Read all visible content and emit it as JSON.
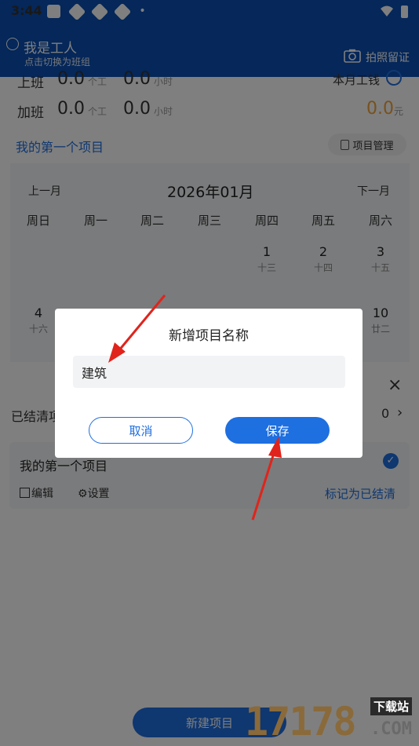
{
  "status_bar": {
    "time": "3:44",
    "dot": "•"
  },
  "header": {
    "role_title": "我是工人",
    "role_subtitle": "点击切换为班组",
    "photo_label": "拍照留证",
    "icons": [
      "switch-icon",
      "camera-icon"
    ]
  },
  "stats": {
    "row1": {
      "label": "上班",
      "value1": "0.0",
      "unit1": "个工",
      "value2": "0.0",
      "unit2": "小时",
      "right_label": "本月工钱"
    },
    "row2": {
      "label": "加班",
      "value1": "0.0",
      "unit1": "个工",
      "value2": "0.0",
      "unit2": "小时",
      "right_value": "0.0",
      "right_unit": "元"
    },
    "right_value_color": "#f0a33a"
  },
  "project": {
    "title": "我的第一个项目",
    "manage_label": "项目管理"
  },
  "calendar": {
    "prev": "上一月",
    "next": "下一月",
    "month": "2026年01月",
    "weekdays": [
      "周日",
      "周一",
      "周二",
      "周三",
      "周四",
      "周五",
      "周六"
    ],
    "row1": [
      {
        "day": "1",
        "lunar": "十三"
      },
      {
        "day": "2",
        "lunar": "十四"
      },
      {
        "day": "3",
        "lunar": "十五"
      }
    ],
    "row2": [
      {
        "day": "4",
        "lunar": "十六"
      },
      {
        "day": "10",
        "lunar": "廿二"
      }
    ]
  },
  "sheet": {
    "close": "×",
    "settled_label": "已结清项",
    "settled_count": "0",
    "card": {
      "title": "我的第一个项目",
      "edit": "编辑",
      "settings": "设置",
      "mark_settled": "标记为已结清"
    },
    "new_project": "新建项目"
  },
  "dialog": {
    "title": "新增项目名称",
    "input_value": "建筑",
    "cancel": "取消",
    "save": "保存"
  },
  "watermark": {
    "number": "17178",
    "suffix": ".COM",
    "tag": "下载站"
  },
  "colors": {
    "header_blue": "#0b4fb2",
    "accent_blue": "#1e6fe0",
    "arrow_red": "#e0241b"
  }
}
